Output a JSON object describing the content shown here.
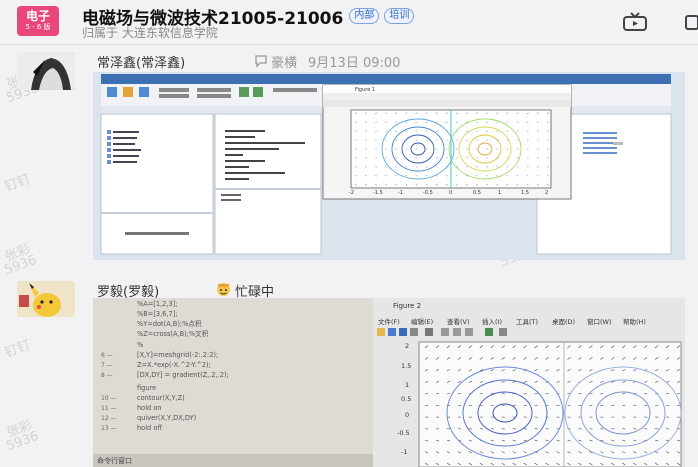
{
  "group": {
    "avatar_line1": "电子",
    "avatar_line2": "5 - 6 版",
    "title": "电磁场与微波技术21005-21006",
    "tags": [
      "内部",
      "培训"
    ],
    "subtitle": "归属于 大连东软信息学院"
  },
  "messages": [
    {
      "sender": "常泽鑫(常泽鑫)",
      "status_text": "豪横",
      "timestamp": "9月13日 09:00",
      "image_desc_icon": "matlab-screenshot",
      "code_lines": [
        "x = -2:0.2:2;",
        "y = x';",
        "z = x .* exp(-x.^2 - y.^2);",
        "[px,py] = gradient(z);",
        "figure",
        "contour(x,y,z)",
        "hold on",
        "quiver(x,y,px,py)",
        "hold off"
      ],
      "figure_title": "Figure 1",
      "axis_ticks_x": [
        "-2",
        "-1.5",
        "-1",
        "-0.5",
        "0",
        "0.5",
        "1",
        "1.5",
        "2"
      ],
      "axis_ticks_y": [
        "2",
        "1.5",
        "1",
        "0.5",
        "0",
        "-0.5",
        "-1",
        "-1.5",
        "-2"
      ]
    },
    {
      "sender": "罗毅(罗毅)",
      "status_text": "忙碌中",
      "image_desc_icon": "matlab-photo",
      "code_lines": [
        "%A=[1,2,3];",
        "%B=[3,6,7];",
        "%Y=dot(A,B);%点积",
        "%Z=cross(A,B);%叉积",
        "%",
        "[X,Y]=meshgrid(-2:.2:2);",
        "Z=X.*exp(-X.^2-Y.^2);",
        "[DX,DY] = gradient(Z,.2,.2);",
        "figure",
        "contour(X,Y,Z)",
        "hold on",
        "quiver(X,Y,DX,DY)",
        "hold off"
      ],
      "line_numbers": [
        "",
        "",
        "",
        "",
        "",
        "6 —",
        "7 —",
        "8 —",
        "",
        "10 —",
        "11 —",
        "12 —",
        "13 —"
      ],
      "figure_title": "Figure 2",
      "figure_menu": [
        "文件(F)",
        "编辑(E)",
        "查看(V)",
        "插入(I)",
        "工具(T)",
        "桌面(D)",
        "窗口(W)",
        "帮助(H)"
      ],
      "axis_ticks_y": [
        "2",
        "1.5",
        "1",
        "0.5",
        "0",
        "-0.5",
        "-1"
      ],
      "cmd_window": "命令行窗口"
    }
  ],
  "watermark": [
    "张彩",
    "5936",
    "钉钉"
  ],
  "colors": {
    "accent": "#e9477a",
    "tag_blue": "#2e66c7",
    "matlab_bg": "#ffffff"
  }
}
